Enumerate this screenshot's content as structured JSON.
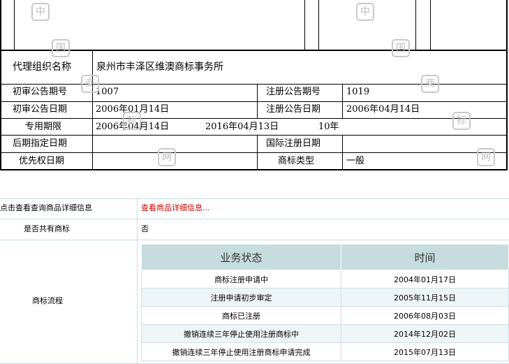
{
  "certificate": {
    "agency_label": "代理组织名称",
    "agency_value": "泉州市丰泽区维澳商标事务所",
    "prelim_issue_label": "初审公告期号",
    "prelim_issue_value": "1007",
    "reg_issue_label": "注册公告期号",
    "reg_issue_value": "1019",
    "prelim_date_label": "初审公告日期",
    "prelim_date_value": "2006年01月14日",
    "reg_date_label": "注册公告日期",
    "reg_date_value": "2006年04月14日",
    "exclusive_label": "专用期限",
    "exclusive_start": "2006年04月14日",
    "exclusive_end": "2016年04月13日",
    "exclusive_years": "10年",
    "later_designation_label": "后期指定日期",
    "later_designation_value": "",
    "intl_reg_label": "国际注册日期",
    "intl_reg_value": "",
    "priority_label": "优先权日期",
    "priority_value": "",
    "tm_type_label": "商标类型",
    "tm_type_value": "一般",
    "watermarks": [
      "中",
      "国",
      "商",
      "标",
      "网"
    ]
  },
  "details": {
    "goods_label": "点击查看查询商品详细信息",
    "goods_link": "查看商品详细信息...",
    "shared_label": "是否共有商标",
    "shared_value": "否",
    "flow_label": "商标流程"
  },
  "flow_table": {
    "headers": [
      "业务状态",
      "时间"
    ],
    "rows": [
      {
        "status": "商标注册申请中",
        "date": "2004年01月17日"
      },
      {
        "status": "注册申请初步审定",
        "date": "2005年11月15日"
      },
      {
        "status": "商标已注册",
        "date": "2006年08月03日"
      },
      {
        "status": "撤销连续三年停止使用注册商标中",
        "date": "2014年12月02日"
      },
      {
        "status": "撤销连续三年停止使用注册商标申请完成",
        "date": "2015年07月13日"
      }
    ]
  }
}
